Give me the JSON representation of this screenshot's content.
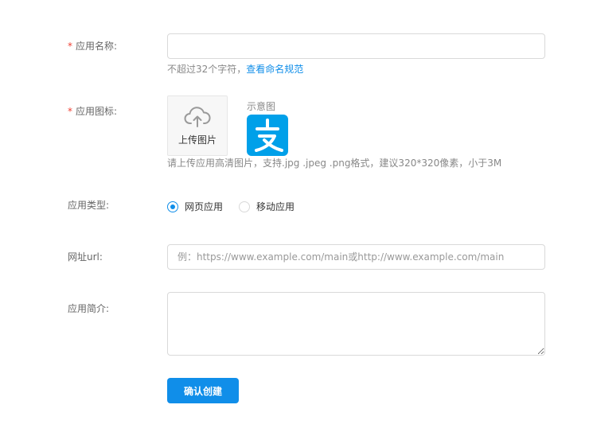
{
  "form": {
    "app_name": {
      "required_mark": "*",
      "label": "应用名称:",
      "value": "",
      "help_text": "不超过32个字符，",
      "help_link": "查看命名规范"
    },
    "app_icon": {
      "required_mark": "*",
      "label": "应用图标:",
      "upload_icon": "cloud-upload-icon",
      "upload_text": "上传图片",
      "sample_label": "示意图",
      "sample_logo": "alipay-logo",
      "sample_logo_color": "#00a0e9",
      "help_text": "请上传应用高清图片，支持.jpg .jpeg .png格式，建议320*320像素，小于3M"
    },
    "app_type": {
      "label": "应用类型:",
      "options": [
        {
          "label": "网页应用",
          "checked": true
        },
        {
          "label": "移动应用",
          "checked": false
        }
      ]
    },
    "url": {
      "label": "网址url:",
      "value": "",
      "placeholder": "例：https://www.example.com/main或http://www.example.com/main"
    },
    "description": {
      "label": "应用简介:",
      "value": ""
    },
    "submit_label": "确认创建"
  },
  "colors": {
    "primary": "#108ee9",
    "required": "#f04134",
    "label": "#666666",
    "help": "#888888",
    "border": "#d9d9d9"
  }
}
